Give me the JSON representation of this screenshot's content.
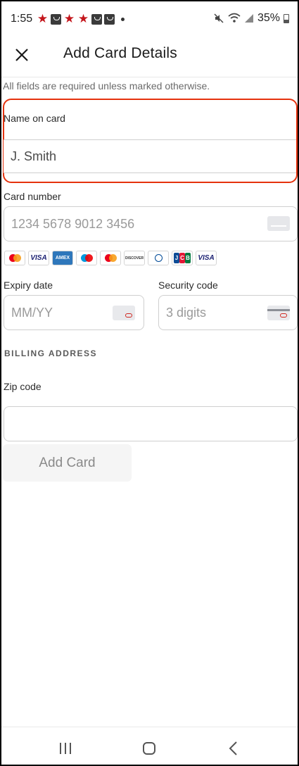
{
  "status_bar": {
    "time": "1:55",
    "battery": "35%"
  },
  "header": {
    "title": "Add Card Details"
  },
  "form": {
    "note": "All fields are required unless marked otherwise.",
    "name_label": "Name on card",
    "name_value": "J. Smith",
    "card_number_label": "Card number",
    "card_number_placeholder": "1234 5678 9012 3456",
    "expiry_label": "Expiry date",
    "expiry_placeholder": "MM/YY",
    "security_label": "Security code",
    "security_placeholder": "3 digits",
    "billing_title": "BILLING ADDRESS",
    "zip_label": "Zip code",
    "zip_value": "",
    "add_button": "Add Card"
  },
  "brands": {
    "visa": "VISA",
    "amex": "AMEX",
    "discover": "DISCOVER",
    "jcb": "JCB"
  },
  "colors": {
    "highlight": "#e5320e",
    "star": "#c4161c"
  }
}
